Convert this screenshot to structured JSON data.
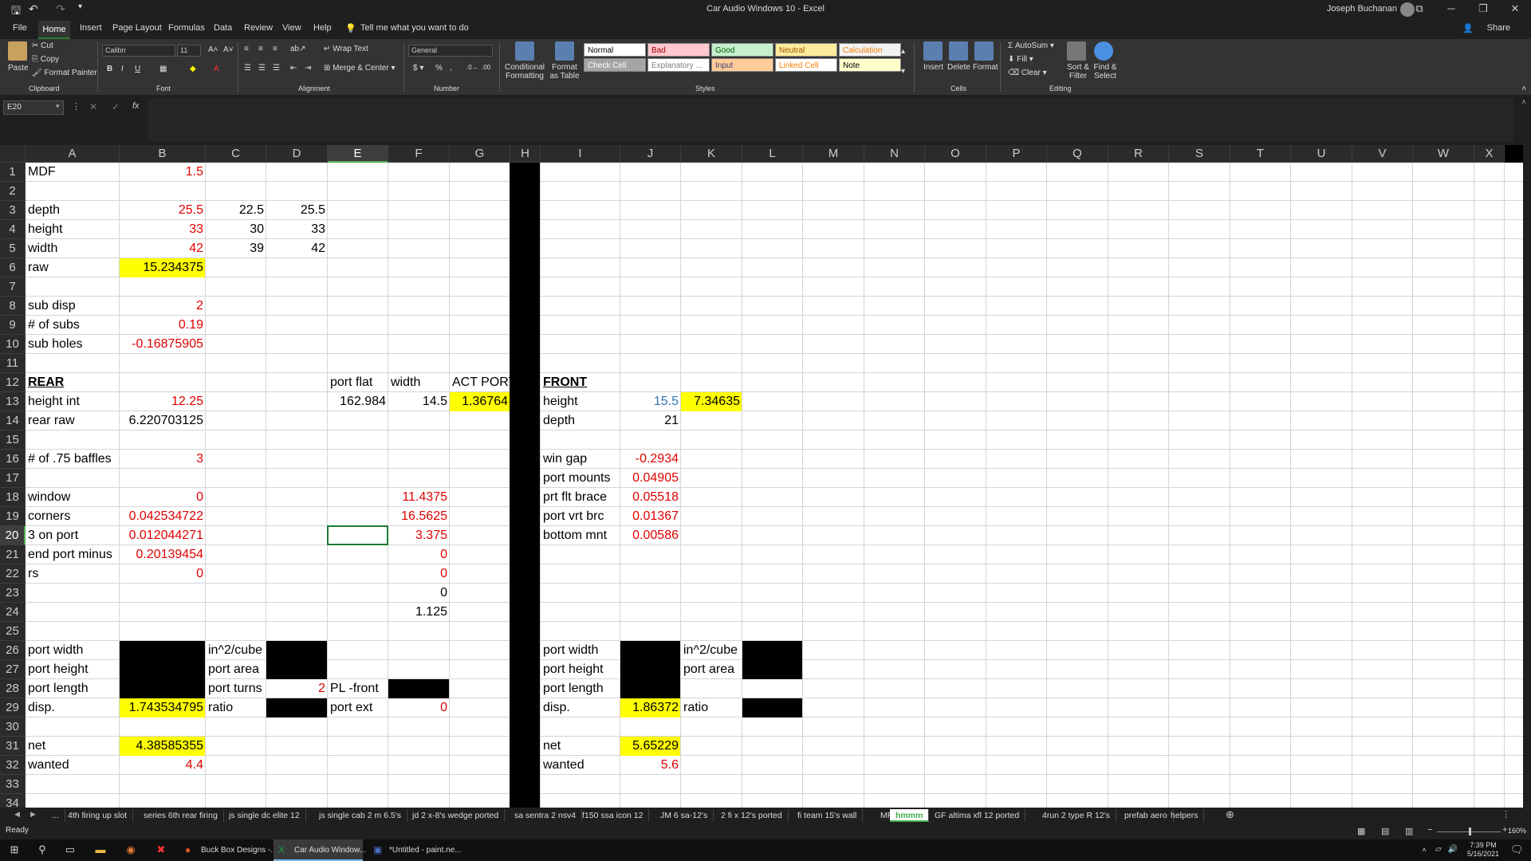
{
  "titlebar": {
    "title": "Car Audio Windows 10  -  Excel",
    "user": "Joseph Buchanan"
  },
  "menu": {
    "tabs": [
      "File",
      "Home",
      "Insert",
      "Page Layout",
      "Formulas",
      "Data",
      "Review",
      "View",
      "Help"
    ],
    "tell_me": "Tell me what you want to do",
    "share": "Share"
  },
  "ribbon": {
    "clipboard": {
      "paste": "Paste",
      "cut": "Cut",
      "copy": "Copy",
      "format_painter": "Format Painter",
      "title": "Clipboard"
    },
    "font": {
      "name": "Calibri",
      "size": "11",
      "title": "Font"
    },
    "alignment": {
      "wrap_text": "Wrap Text",
      "merge_center": "Merge & Center",
      "title": "Alignment"
    },
    "number": {
      "format": "General",
      "title": "Number"
    },
    "styles": {
      "conditional_formatting": "Conditional Formatting",
      "format_as_table": "Format as Table",
      "title": "Styles",
      "cells": [
        {
          "label": "Normal",
          "bg": "#ffffff",
          "fg": "#000000"
        },
        {
          "label": "Bad",
          "bg": "#ffc7ce",
          "fg": "#9c0006"
        },
        {
          "label": "Good",
          "bg": "#c6efce",
          "fg": "#006100"
        },
        {
          "label": "Neutral",
          "bg": "#ffeb9c",
          "fg": "#9c5700"
        },
        {
          "label": "Calculation",
          "bg": "#f2f2f2",
          "fg": "#fa7d00"
        },
        {
          "label": "Check Cell",
          "bg": "#a5a5a5",
          "fg": "#ffffff"
        },
        {
          "label": "Explanatory ...",
          "bg": "#ffffff",
          "fg": "#7f7f7f"
        },
        {
          "label": "Input",
          "bg": "#ffcc99",
          "fg": "#3f3f76"
        },
        {
          "label": "Linked Cell",
          "bg": "#ffffff",
          "fg": "#fa7d00"
        },
        {
          "label": "Note",
          "bg": "#ffffcc",
          "fg": "#000000"
        }
      ]
    },
    "cells": {
      "insert": "Insert",
      "delete": "Delete",
      "format": "Format",
      "title": "Cells"
    },
    "editing": {
      "autosum": "AutoSum",
      "fill": "Fill",
      "clear": "Clear",
      "sort_filter": "Sort & Filter",
      "find_select": "Find & Select",
      "title": "Editing"
    }
  },
  "formula_bar": {
    "name_box": "E20",
    "formula": ""
  },
  "columns": [
    "A",
    "B",
    "C",
    "D",
    "E",
    "F",
    "G",
    "H",
    "I",
    "J",
    "K",
    "L",
    "M",
    "N",
    "O",
    "P",
    "Q",
    "R",
    "S",
    "T",
    "U",
    "V",
    "W",
    "X"
  ],
  "selected_cell": "E20",
  "cells": [
    {
      "ref": "A1",
      "v": "MDF"
    },
    {
      "ref": "B1",
      "v": "1.5",
      "c": "red",
      "r": true
    },
    {
      "ref": "A3",
      "v": "depth"
    },
    {
      "ref": "B3",
      "v": "25.5",
      "c": "red",
      "r": true
    },
    {
      "ref": "C3",
      "v": "22.5",
      "r": true
    },
    {
      "ref": "D3",
      "v": "25.5",
      "r": true
    },
    {
      "ref": "A4",
      "v": "height"
    },
    {
      "ref": "B4",
      "v": "33",
      "c": "red",
      "r": true
    },
    {
      "ref": "C4",
      "v": "30",
      "r": true
    },
    {
      "ref": "D4",
      "v": "33",
      "r": true
    },
    {
      "ref": "A5",
      "v": "width"
    },
    {
      "ref": "B5",
      "v": "42",
      "c": "red",
      "r": true
    },
    {
      "ref": "C5",
      "v": "39",
      "r": true
    },
    {
      "ref": "D5",
      "v": "42",
      "r": true
    },
    {
      "ref": "A6",
      "v": "raw"
    },
    {
      "ref": "B6",
      "v": "15.234375",
      "r": true,
      "fill": "yellow"
    },
    {
      "ref": "A8",
      "v": "sub disp"
    },
    {
      "ref": "B8",
      "v": "2",
      "c": "red",
      "r": true
    },
    {
      "ref": "A9",
      "v": "# of subs"
    },
    {
      "ref": "B9",
      "v": "0.19",
      "c": "red",
      "r": true
    },
    {
      "ref": "A10",
      "v": "sub holes"
    },
    {
      "ref": "B10",
      "v": "-0.16875905",
      "c": "red",
      "r": true
    },
    {
      "ref": "A12",
      "v": "REAR",
      "ul": true
    },
    {
      "ref": "E12",
      "v": "port flat"
    },
    {
      "ref": "F12",
      "v": "width"
    },
    {
      "ref": "G12",
      "v": "ACT PORT"
    },
    {
      "ref": "I12",
      "v": "FRONT",
      "ul": true
    },
    {
      "ref": "A13",
      "v": "height int"
    },
    {
      "ref": "B13",
      "v": "12.25",
      "c": "red",
      "r": true
    },
    {
      "ref": "E13",
      "v": "162.984",
      "r": true
    },
    {
      "ref": "F13",
      "v": "14.5",
      "r": true
    },
    {
      "ref": "G13",
      "v": "1.36764",
      "r": true,
      "fill": "yellow"
    },
    {
      "ref": "I13",
      "v": "height"
    },
    {
      "ref": "J13",
      "v": "15.5",
      "c": "blue",
      "r": true
    },
    {
      "ref": "K13",
      "v": "7.34635",
      "r": true,
      "fill": "yellow"
    },
    {
      "ref": "A14",
      "v": "rear raw"
    },
    {
      "ref": "B14",
      "v": "6.220703125",
      "r": true
    },
    {
      "ref": "I14",
      "v": "depth"
    },
    {
      "ref": "J14",
      "v": "21",
      "r": true
    },
    {
      "ref": "A16",
      "v": "# of .75 baffles"
    },
    {
      "ref": "B16",
      "v": "3",
      "c": "red",
      "r": true
    },
    {
      "ref": "I16",
      "v": "win gap"
    },
    {
      "ref": "J16",
      "v": "-0.2934",
      "c": "red",
      "r": true
    },
    {
      "ref": "I17",
      "v": "port mounts"
    },
    {
      "ref": "J17",
      "v": "0.04905",
      "c": "red",
      "r": true
    },
    {
      "ref": "A18",
      "v": "window"
    },
    {
      "ref": "B18",
      "v": "0",
      "c": "red",
      "r": true
    },
    {
      "ref": "F18",
      "v": "11.4375",
      "c": "red",
      "r": true
    },
    {
      "ref": "I18",
      "v": "prt flt brace"
    },
    {
      "ref": "J18",
      "v": "0.05518",
      "c": "red",
      "r": true
    },
    {
      "ref": "A19",
      "v": "corners"
    },
    {
      "ref": "B19",
      "v": "0.042534722",
      "c": "red",
      "r": true
    },
    {
      "ref": "F19",
      "v": "16.5625",
      "c": "red",
      "r": true
    },
    {
      "ref": "I19",
      "v": "port vrt brc"
    },
    {
      "ref": "J19",
      "v": "0.01367",
      "c": "red",
      "r": true
    },
    {
      "ref": "A20",
      "v": "3 on port"
    },
    {
      "ref": "B20",
      "v": "0.012044271",
      "c": "red",
      "r": true
    },
    {
      "ref": "F20",
      "v": "3.375",
      "c": "red",
      "r": true
    },
    {
      "ref": "I20",
      "v": "bottom mnt"
    },
    {
      "ref": "J20",
      "v": "0.00586",
      "c": "red",
      "r": true
    },
    {
      "ref": "A21",
      "v": "end port minus"
    },
    {
      "ref": "B21",
      "v": "0.20139454",
      "c": "red",
      "r": true
    },
    {
      "ref": "F21",
      "v": "0",
      "c": "red",
      "r": true
    },
    {
      "ref": "A22",
      "v": "rs"
    },
    {
      "ref": "B22",
      "v": "0",
      "c": "red",
      "r": true
    },
    {
      "ref": "F22",
      "v": "0",
      "c": "red",
      "r": true
    },
    {
      "ref": "F23",
      "v": "0",
      "r": true
    },
    {
      "ref": "F24",
      "v": "1.125",
      "r": true
    },
    {
      "ref": "A26",
      "v": "port width"
    },
    {
      "ref": "B26",
      "v": "",
      "fill": "black"
    },
    {
      "ref": "C26",
      "v": "in^2/cube"
    },
    {
      "ref": "D26",
      "v": "",
      "fill": "black"
    },
    {
      "ref": "I26",
      "v": "port width"
    },
    {
      "ref": "J26",
      "v": "",
      "fill": "black"
    },
    {
      "ref": "K26",
      "v": "in^2/cube"
    },
    {
      "ref": "L26",
      "v": "",
      "fill": "black"
    },
    {
      "ref": "A27",
      "v": "port height"
    },
    {
      "ref": "B27",
      "v": "",
      "fill": "black"
    },
    {
      "ref": "C27",
      "v": "port area"
    },
    {
      "ref": "D27",
      "v": "",
      "fill": "black"
    },
    {
      "ref": "I27",
      "v": "port height"
    },
    {
      "ref": "J27",
      "v": "",
      "fill": "black"
    },
    {
      "ref": "K27",
      "v": "port area"
    },
    {
      "ref": "L27",
      "v": "",
      "fill": "black"
    },
    {
      "ref": "A28",
      "v": "port length"
    },
    {
      "ref": "B28",
      "v": "",
      "fill": "black"
    },
    {
      "ref": "C28",
      "v": "port turns"
    },
    {
      "ref": "D28",
      "v": "2",
      "c": "red",
      "r": true
    },
    {
      "ref": "E28",
      "v": "PL -front"
    },
    {
      "ref": "F28",
      "v": "",
      "fill": "black"
    },
    {
      "ref": "I28",
      "v": "port length"
    },
    {
      "ref": "J28",
      "v": "",
      "fill": "black"
    },
    {
      "ref": "A29",
      "v": "disp."
    },
    {
      "ref": "B29",
      "v": "1.743534795",
      "r": true,
      "fill": "yellow"
    },
    {
      "ref": "C29",
      "v": "ratio"
    },
    {
      "ref": "D29",
      "v": "",
      "fill": "black"
    },
    {
      "ref": "E29",
      "v": "port ext"
    },
    {
      "ref": "F29",
      "v": "0",
      "c": "red",
      "r": true
    },
    {
      "ref": "I29",
      "v": "disp."
    },
    {
      "ref": "J29",
      "v": "1.86372",
      "r": true,
      "fill": "yellow"
    },
    {
      "ref": "K29",
      "v": "ratio"
    },
    {
      "ref": "L29",
      "v": "",
      "fill": "black"
    },
    {
      "ref": "A31",
      "v": "net"
    },
    {
      "ref": "B31",
      "v": "4.38585355",
      "r": true,
      "fill": "yellow"
    },
    {
      "ref": "I31",
      "v": "net"
    },
    {
      "ref": "J31",
      "v": "5.65229",
      "r": true,
      "fill": "yellow"
    },
    {
      "ref": "A32",
      "v": "wanted"
    },
    {
      "ref": "B32",
      "v": "4.4",
      "c": "red",
      "r": true
    },
    {
      "ref": "I32",
      "v": "wanted"
    },
    {
      "ref": "J32",
      "v": "5.6",
      "c": "red",
      "r": true
    }
  ],
  "sheet_tabs": [
    "...",
    "4th firing up slot",
    "series 6th rear firing",
    "js single dc elite 12",
    "js single cab 2 m 6.5's",
    "jd 2 x-8's wedge ported",
    "sa sentra 2 nsv4",
    "f150 ssa icon 12",
    "JM 6 sa-12's",
    "2 fi x 12's ported",
    "fi team 15's wall",
    "MR",
    "hmmm",
    "GF altima xfl 12 ported",
    "4run 2 type R 12's",
    "prefab aero",
    "helpers"
  ],
  "active_sheet": "hmmm",
  "status": {
    "text": "Ready",
    "zoom": "160%"
  },
  "taskbar": {
    "apps": [
      {
        "label": "Buck Box Designs -...",
        "active": false
      },
      {
        "label": "Car Audio Window...",
        "active": true
      },
      {
        "label": "*Untitled - paint.ne...",
        "active": false
      }
    ],
    "time": "7:39 PM",
    "date": "5/16/2021"
  }
}
